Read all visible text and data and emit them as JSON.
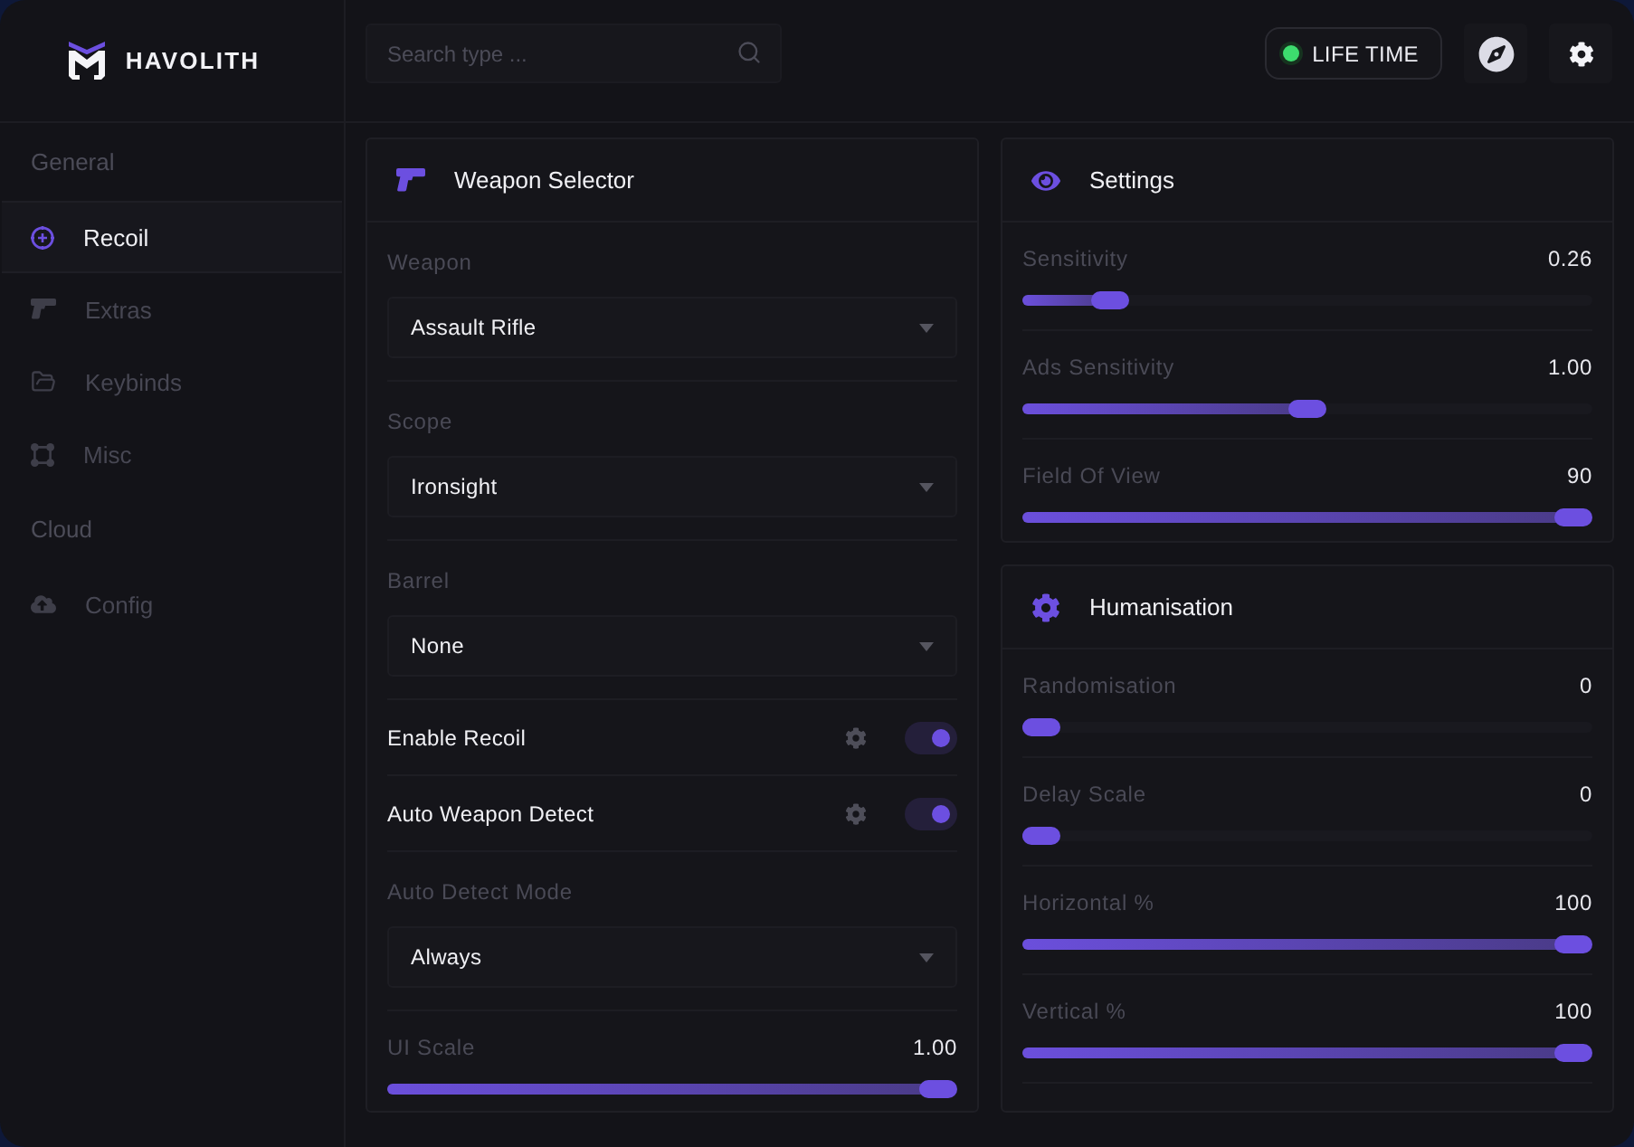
{
  "brand": {
    "name": "HAVOLITH"
  },
  "sidebar": {
    "sections": [
      {
        "title": "General",
        "items": [
          {
            "label": "Recoil",
            "selected": true
          },
          {
            "label": "Extras",
            "selected": false
          },
          {
            "label": "Keybinds",
            "selected": false
          },
          {
            "label": "Misc",
            "selected": false
          }
        ]
      },
      {
        "title": "Cloud",
        "items": [
          {
            "label": "Config",
            "selected": false
          }
        ]
      }
    ]
  },
  "search": {
    "placeholder": "Search type ..."
  },
  "license": {
    "label": "LIFE TIME",
    "active": true
  },
  "columns": [
    {
      "panels": [
        {
          "title": "Weapon Selector",
          "rows": [
            {
              "kind": "select",
              "label": "Weapon",
              "value": "Assault Rifle"
            },
            {
              "kind": "select",
              "label": "Scope",
              "value": "Ironsight"
            },
            {
              "kind": "select",
              "label": "Barrel",
              "value": "None"
            },
            {
              "kind": "toggle",
              "label": "Enable Recoil",
              "on": true
            },
            {
              "kind": "toggle",
              "label": "Auto Weapon Detect",
              "on": true
            },
            {
              "kind": "select",
              "label": "Auto Detect Mode",
              "value": "Always"
            },
            {
              "kind": "slider",
              "label": "UI Scale",
              "reading": "1.00",
              "level": 1
            }
          ]
        }
      ]
    },
    {
      "panels": [
        {
          "title": "Settings",
          "rows": [
            {
              "kind": "slider",
              "label": "Sensitivity",
              "reading": "0.26",
              "level": 0.13
            },
            {
              "kind": "slider",
              "label": "Ads Sensitivity",
              "reading": "1.00",
              "level": 0.5
            },
            {
              "kind": "slider",
              "label": "Field Of View",
              "reading": "90",
              "level": 1
            }
          ]
        },
        {
          "title": "Humanisation",
          "rows": [
            {
              "kind": "slider",
              "label": "Randomisation",
              "reading": "0",
              "level": 0
            },
            {
              "kind": "slider",
              "label": "Delay Scale",
              "reading": "0",
              "level": 0
            },
            {
              "kind": "slider",
              "label": "Horizontal %",
              "reading": "100",
              "level": 1
            },
            {
              "kind": "slider",
              "label": "Vertical %",
              "reading": "100",
              "level": 1
            }
          ]
        }
      ]
    }
  ]
}
